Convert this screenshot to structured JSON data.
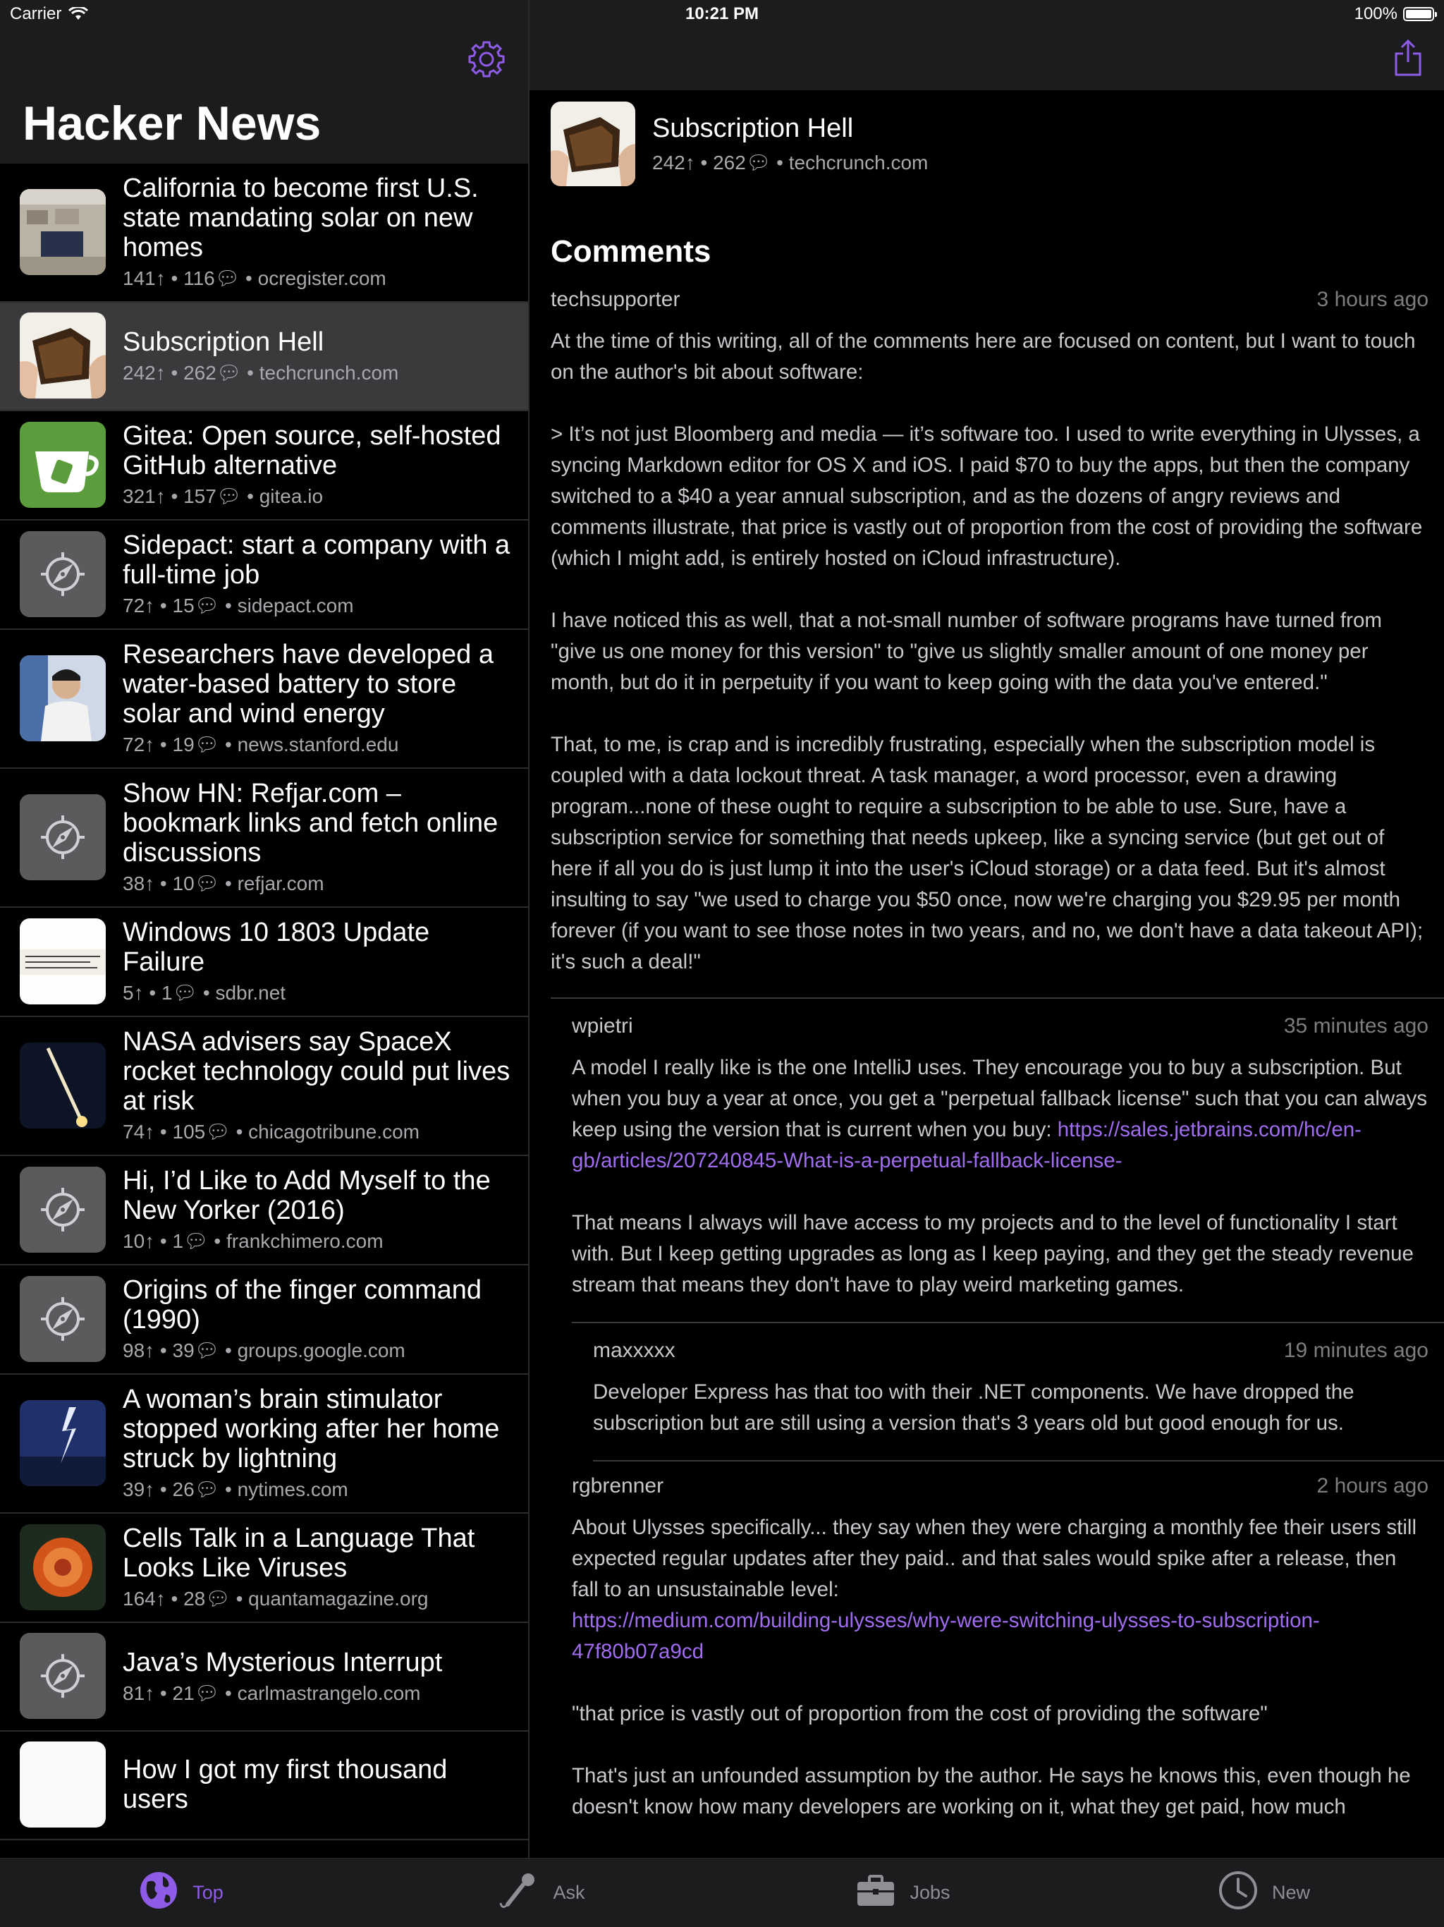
{
  "status_bar": {
    "carrier": "Carrier",
    "time": "10:21 PM",
    "battery": "100%"
  },
  "sidebar": {
    "title": "Hacker News",
    "stories": [
      {
        "title": "California to become first U.S. state mandating solar on new homes",
        "points": "141",
        "comments": "116",
        "domain": "ocregister.com",
        "thumb": "roofs"
      },
      {
        "title": "Subscription Hell",
        "points": "242",
        "comments": "262",
        "domain": "techcrunch.com",
        "thumb": "wallet",
        "selected": true
      },
      {
        "title": "Gitea: Open source, self-hosted GitHub alternative",
        "points": "321",
        "comments": "157",
        "domain": "gitea.io",
        "thumb": "gitea"
      },
      {
        "title": "Sidepact: start a company with a full-time job",
        "points": "72",
        "comments": "15",
        "domain": "sidepact.com",
        "thumb": "compass"
      },
      {
        "title": "Researchers have developed a water-based battery to store solar and wind energy",
        "points": "72",
        "comments": "19",
        "domain": "news.stanford.edu",
        "thumb": "person"
      },
      {
        "title": "Show HN: Refjar.com – bookmark links and fetch online discussions",
        "points": "38",
        "comments": "10",
        "domain": "refjar.com",
        "thumb": "compass"
      },
      {
        "title": "Windows 10 1803 Update Failure",
        "points": "5",
        "comments": "1",
        "domain": "sdbr.net",
        "thumb": "paper"
      },
      {
        "title": "NASA advisers say SpaceX rocket technology could put lives at risk",
        "points": "74",
        "comments": "105",
        "domain": "chicagotribune.com",
        "thumb": "rocket"
      },
      {
        "title": "Hi, I’d Like to Add Myself to the New Yorker (2016)",
        "points": "10",
        "comments": "1",
        "domain": "frankchimero.com",
        "thumb": "compass"
      },
      {
        "title": "Origins of the finger command (1990)",
        "points": "98",
        "comments": "39",
        "domain": "groups.google.com",
        "thumb": "compass"
      },
      {
        "title": "A woman’s brain stimulator stopped working after her home struck by lightning",
        "points": "39",
        "comments": "26",
        "domain": "nytimes.com",
        "thumb": "lightning"
      },
      {
        "title": "Cells Talk in a Language That Looks Like Viruses",
        "points": "164",
        "comments": "28",
        "domain": "quantamagazine.org",
        "thumb": "virus"
      },
      {
        "title": "Java’s Mysterious Interrupt",
        "points": "81",
        "comments": "21",
        "domain": "carlmastrangelo.com",
        "thumb": "compass"
      },
      {
        "title": "How I got my first thousand users",
        "points": "",
        "comments": "",
        "domain": "",
        "thumb": "white"
      }
    ]
  },
  "detail": {
    "title": "Subscription Hell",
    "points": "242",
    "comments": "262",
    "domain": "techcrunch.com",
    "comments_heading": "Comments",
    "thread": [
      {
        "author": "techsupporter",
        "age": "3 hours ago",
        "level": "lvl0",
        "paragraphs": [
          "At the time of this writing, all of the comments here are focused on content, but I want to touch on the author's bit about software:",
          "> It’s not just Bloomberg and media — it’s software too. I used to write everything in Ulysses, a syncing Markdown editor for OS X and iOS. I paid $70 to buy the apps, but then the company switched to a $40 a year annual subscription, and as the dozens of angry reviews and comments illustrate, that price is vastly out of proportion from the cost of providing the software (which I might add, is entirely hosted on iCloud infrastructure).",
          "I have noticed this as well, that a not-small number of software programs have turned from \"give us one money for this version\" to \"give us slightly smaller amount of one money per month, but do it in perpetuity if you want to keep going with the data you've entered.\"",
          "That, to me, is crap and is incredibly frustrating, especially when the subscription model is coupled with a data lockout threat.  A task manager, a word processor, even a drawing program...none of these ought to require a subscription to be able to use.  Sure, have a subscription service for something that needs upkeep, like a syncing service (but get out of here if all you do is just lump it into the user's iCloud storage) or a data feed.  But it's almost insulting to say \"we used to charge you $50 once, now we're charging you $29.95 per month forever (if you want to see those notes in two years, and no, we don't have a data takeout API); it's such a deal!\""
        ]
      },
      {
        "author": "wpietri",
        "age": "35 minutes ago",
        "level": "lvl1",
        "paragraphs": [
          "A model I really like is the one IntelliJ uses. They encourage you to buy a subscription. But when you buy a year at once, you get a \"perpetual fallback license\" such that you can always keep using the version that is current when you buy: ",
          "That means I always will have access to my projects and to the level of functionality I start with. But I keep getting upgrades as long as I keep paying, and they get the steady revenue stream that means they don't have to play weird marketing games."
        ],
        "link": "https://sales.jetbrains.com/hc/en-gb/articles/207240845-What-is-a-perpetual-fallback-license-"
      },
      {
        "author": "maxxxxx",
        "age": "19 minutes ago",
        "level": "lvl2",
        "paragraphs": [
          "Developer Express has that too with their .NET components. We have dropped the subscription  but are still using a version that's 3 years old but good enough for us."
        ]
      },
      {
        "author": "rgbrenner",
        "age": "2 hours ago",
        "level": "lvl1b",
        "paragraphs": [
          "About Ulysses specifically... they say when they were charging a monthly fee their users still expected regular updates after they paid.. and that sales would spike after a release, then fall to an unsustainable level:",
          "\"that price is vastly out of proportion from the cost of providing the software\"",
          "That's just an unfounded assumption by the author. He says he knows this, even though he doesn't know how many developers are working on it, what they get paid, how much"
        ],
        "link": "https://medium.com/building-ulysses/why-were-switching-ulysses-to-subscription-47f80b07a9cd"
      }
    ]
  },
  "tabbar": {
    "tabs": [
      {
        "label": "Top",
        "icon": "globe-icon",
        "active": true
      },
      {
        "label": "Ask",
        "icon": "microphone-icon",
        "active": false
      },
      {
        "label": "Jobs",
        "icon": "briefcase-icon",
        "active": false
      },
      {
        "label": "New",
        "icon": "clock-icon",
        "active": false
      }
    ]
  },
  "colors": {
    "accent": "#8e5ce6",
    "link": "#a06cf0",
    "panel": "#1c1c1e",
    "selected_row": "#3a3a3c"
  }
}
